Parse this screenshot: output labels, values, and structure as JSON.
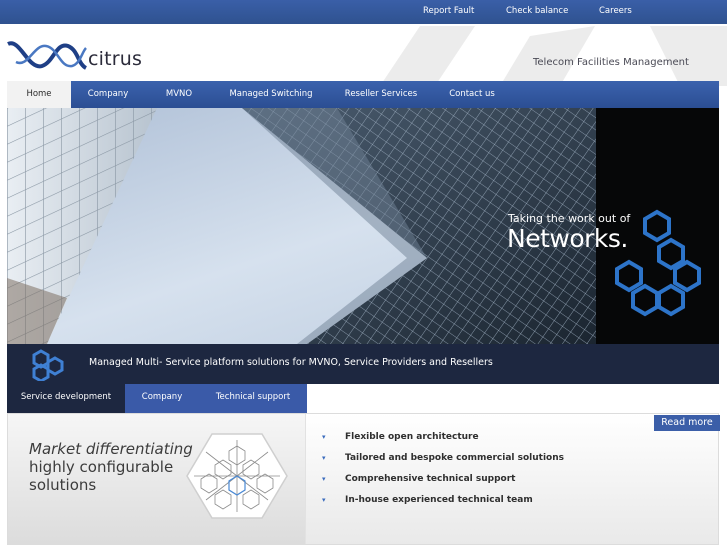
{
  "topbar": {
    "links": [
      "Report Fault",
      "Check balance",
      "Careers"
    ]
  },
  "brand": {
    "name": "citrus",
    "tagline": "Telecom Facilities Management",
    "accent": "#3a5fa8"
  },
  "nav": {
    "items": [
      "Home",
      "Company",
      "MVNO",
      "Managed Switching",
      "Reseller Services",
      "Contact us"
    ],
    "active": "Home"
  },
  "hero": {
    "subtitle": "Taking the work out of",
    "title": "Networks."
  },
  "strip": {
    "text": "Managed Multi- Service platform solutions for MVNO, Service Providers and Resellers"
  },
  "tabs": {
    "items": [
      "Service development",
      "Company",
      "Technical support"
    ],
    "active": "Service development"
  },
  "content": {
    "heading_lines": [
      "Market differentiating",
      "highly configurable",
      "solutions"
    ],
    "features": [
      "Flexible open architecture",
      "Tailored and bespoke commercial solutions",
      "Comprehensive technical support",
      "In-house experienced technical team"
    ],
    "read_more": "Read more"
  }
}
